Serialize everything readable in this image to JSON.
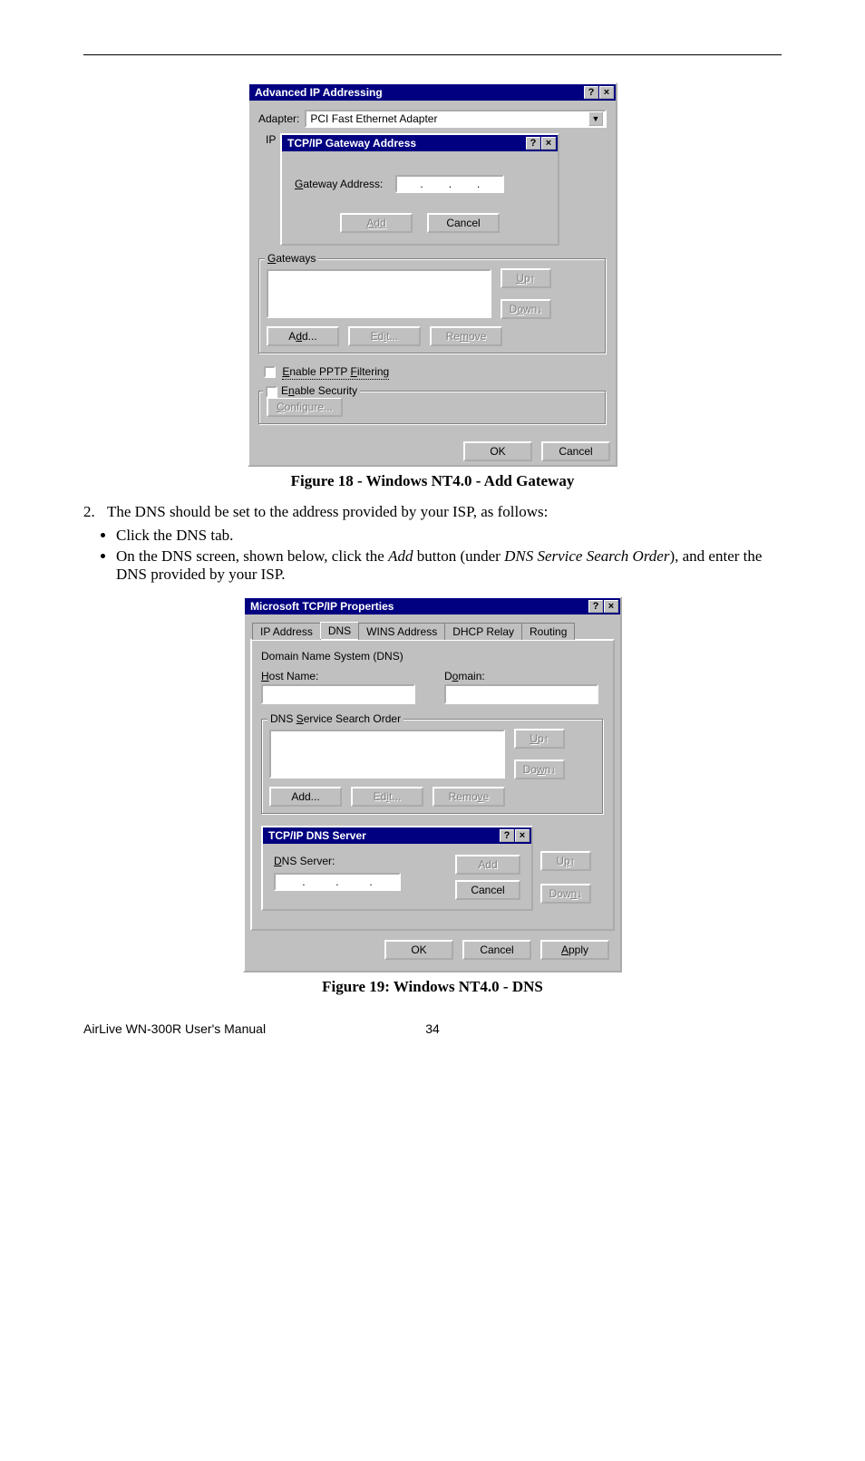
{
  "fig18": {
    "outerTitle": "Advanced IP Addressing",
    "adapterLabel": "Adapter:",
    "adapterValue": "PCI Fast Ethernet Adapter",
    "ipGroupLabel": "IP",
    "dlgTitle": "TCP/IP Gateway Address",
    "gatewayAddrLabel": "Gateway Address:",
    "addBtn": "Add",
    "cancelBtn": "Cancel",
    "gatewaysLegend": "Gateways",
    "upBtn": "Up↑",
    "downBtn": "Down↓",
    "addBtn2": "Add...",
    "editBtn": "Edit...",
    "removeBtn": "Remove",
    "pptpLabel": "Enable PPTP Filtering",
    "secLegend": "Enable Security",
    "configureBtn": "Configure...",
    "okBtn": "OK",
    "cancelBtn2": "Cancel",
    "caption": "Figure 18 - Windows NT4.0 - Add Gateway"
  },
  "body": {
    "listNum": "2.",
    "step2": "The DNS should be set to the address provided by your ISP, as follows:",
    "bullet1": "Click the DNS tab.",
    "bullet2_a": "On the DNS screen, shown below, click the ",
    "bullet2_add": "Add",
    "bullet2_b": " button (under ",
    "bullet2_dns": "DNS Service Search Order",
    "bullet2_c": "), and enter the DNS provided by your ISP."
  },
  "fig19": {
    "title": "Microsoft TCP/IP Properties",
    "tabs": [
      "IP Address",
      "DNS",
      "WINS Address",
      "DHCP Relay",
      "Routing"
    ],
    "dnsGroup": "Domain Name System (DNS)",
    "hostLabel": "Host Name:",
    "domainLabel": "Domain:",
    "serviceLegend": "DNS Service Search Order",
    "upBtn": "Up↑",
    "downBtn": "Down↓",
    "addBtn": "Add...",
    "editBtn": "Edit...",
    "removeBtn": "Remove",
    "innerTitle": "TCP/IP DNS Server",
    "dnsServerLabel": "DNS Server:",
    "innerAdd": "Add",
    "innerCancel": "Cancel",
    "upBtn2": "Up↑",
    "downBtn2": "Down↓",
    "okBtn": "OK",
    "cancelBtn": "Cancel",
    "applyBtn": "Apply",
    "caption": "Figure 19: Windows NT4.0 - DNS"
  },
  "footer": {
    "manual": "AirLive WN-300R User's Manual",
    "page": "34"
  }
}
